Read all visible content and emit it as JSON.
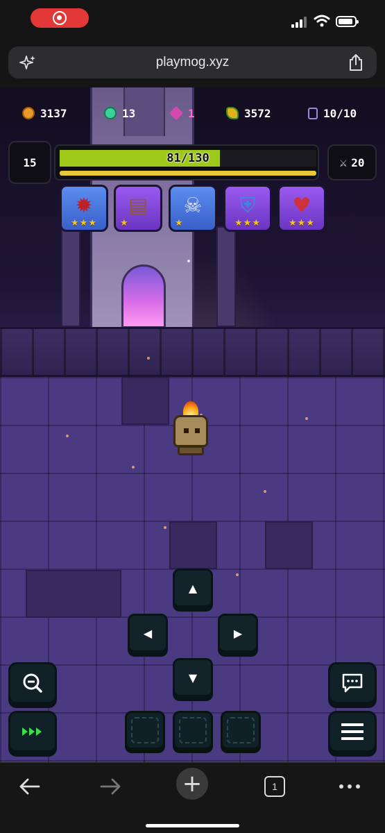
{
  "browser": {
    "url": "playmog.xyz"
  },
  "resources": {
    "gold": "3137",
    "gems": "13",
    "pink": "1",
    "food": "3572",
    "energy": "10/10"
  },
  "player": {
    "level": "15",
    "hp_text": "81/130",
    "hp_fraction": 0.623,
    "xp_fraction": 1.0,
    "attack": "20"
  },
  "equipment": [
    {
      "slot": "weapon",
      "icon": "spiked-helm",
      "rarity": "blue",
      "stars": "★★★"
    },
    {
      "slot": "armor",
      "icon": "barrel-chest",
      "rarity": "purple",
      "stars": "★"
    },
    {
      "slot": "helmet",
      "icon": "skull-plume",
      "rarity": "blue",
      "stars": "★"
    },
    {
      "slot": "shield",
      "icon": "blue-shield",
      "rarity": "purple",
      "stars": "★★★"
    },
    {
      "slot": "ring",
      "icon": "heart-sword",
      "rarity": "purple",
      "stars": "★★★"
    }
  ],
  "controls": {
    "up": "▲",
    "down": "▼",
    "left": "◀",
    "right": "▶"
  },
  "toolbar": {
    "tab_count": "1"
  },
  "colors": {
    "hp": "#9ec91b",
    "xp": "#e8c93a",
    "rarity_blue": "#4a78e0",
    "rarity_purple": "#8a4ae0",
    "star": "#f5c422"
  }
}
